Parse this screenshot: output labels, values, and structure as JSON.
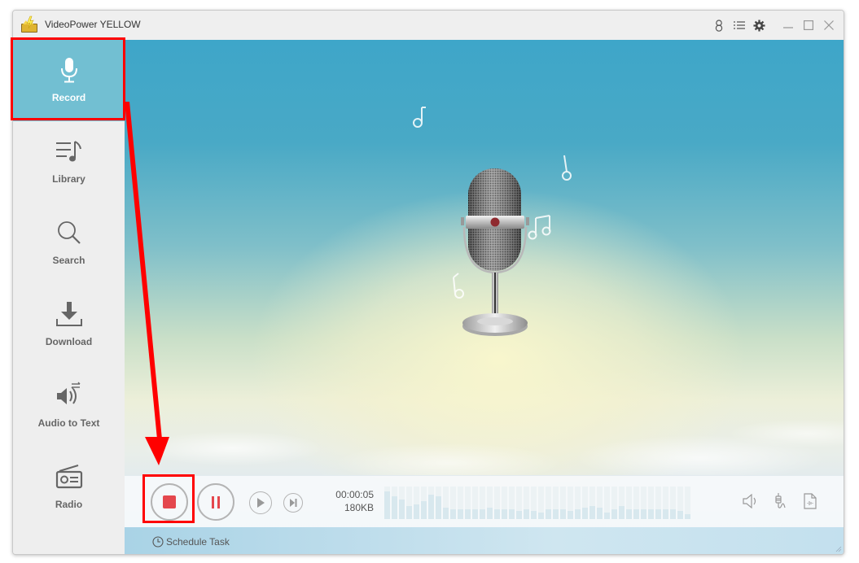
{
  "window": {
    "title": "VideoPower YELLOW",
    "controls": [
      "user-icon",
      "menu-icon",
      "settings-icon",
      "minimize-icon",
      "maximize-icon",
      "close-icon"
    ]
  },
  "sidebar": {
    "items": [
      {
        "label": "Record",
        "icon": "microphone-icon",
        "active": true
      },
      {
        "label": "Library",
        "icon": "music-list-icon",
        "active": false
      },
      {
        "label": "Search",
        "icon": "search-icon",
        "active": false
      },
      {
        "label": "Download",
        "icon": "download-icon",
        "active": false
      },
      {
        "label": "Audio to Text",
        "icon": "audio-to-text-icon",
        "active": false
      },
      {
        "label": "Radio",
        "icon": "radio-icon",
        "active": false
      }
    ]
  },
  "player": {
    "elapsed": "00:00:05",
    "size": "180KB",
    "schedule_label": "Schedule Task",
    "record_button": "stop-record",
    "pause_button": "pause",
    "play_button": "play",
    "next_button": "skip-next",
    "right_icons": [
      "speaker-icon",
      "audio-input-icon",
      "audio-file-icon"
    ],
    "level_meter": [
      0.85,
      0.7,
      0.6,
      0.4,
      0.45,
      0.55,
      0.75,
      0.7,
      0.35,
      0.3,
      0.3,
      0.3,
      0.3,
      0.3,
      0.35,
      0.3,
      0.3,
      0.3,
      0.25,
      0.3,
      0.25,
      0.2,
      0.3,
      0.3,
      0.3,
      0.25,
      0.3,
      0.35,
      0.4,
      0.35,
      0.2,
      0.3,
      0.4,
      0.3,
      0.3,
      0.3,
      0.3,
      0.3,
      0.3,
      0.3,
      0.25,
      0.15
    ]
  },
  "colors": {
    "active_nav": "#72bfd2",
    "record_red": "#e4474d",
    "annotation_red": "#ff0000"
  }
}
